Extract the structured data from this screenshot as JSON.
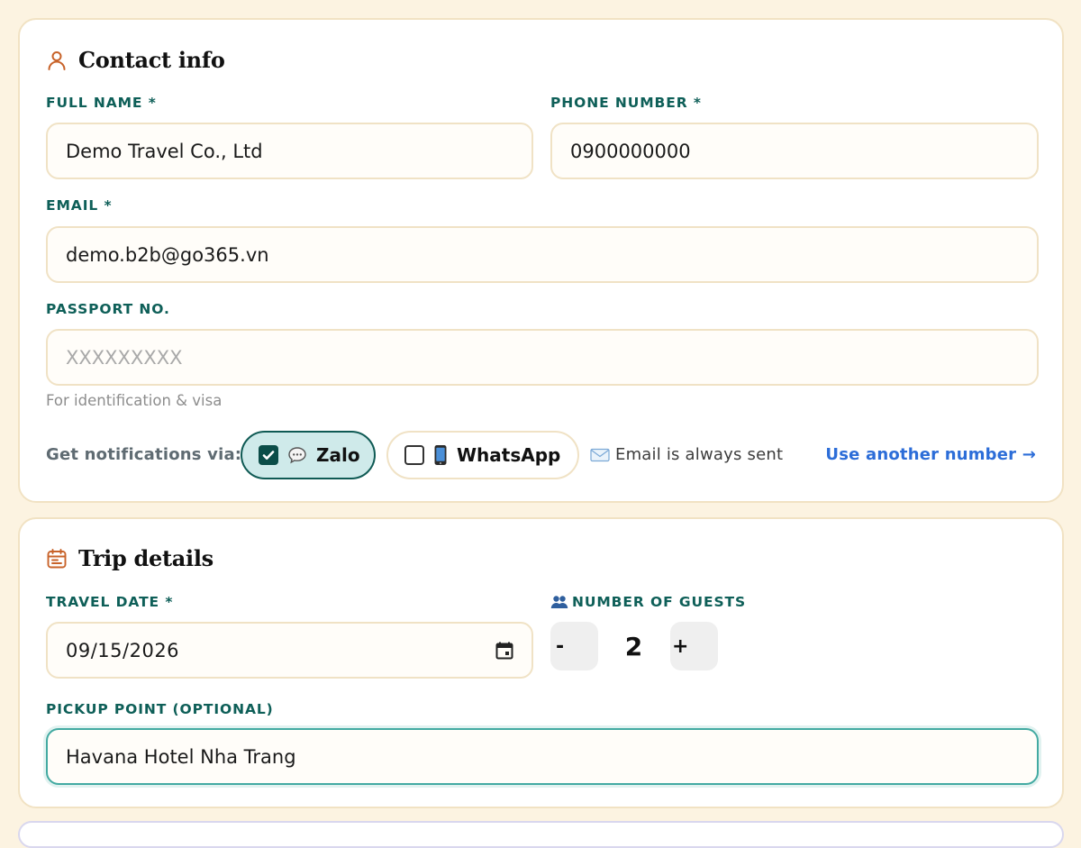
{
  "contact": {
    "title": "Contact info",
    "full_name": {
      "label": "FULL NAME *",
      "value": "Demo Travel Co., Ltd"
    },
    "phone": {
      "label": "PHONE NUMBER *",
      "value": "0900000000"
    },
    "email": {
      "label": "EMAIL *",
      "value": "demo.b2b@go365.vn"
    },
    "passport": {
      "label": "PASSPORT NO.",
      "value": "",
      "placeholder": "XXXXXXXXX",
      "hint": "For identification & visa"
    },
    "notify": {
      "label": "Get notifications via:",
      "zalo": {
        "label": "Zalo",
        "checked": true,
        "icon": "speech-bubble-icon"
      },
      "whatsapp": {
        "label": "WhatsApp",
        "checked": false,
        "icon": "mobile-phone-icon"
      },
      "email_note": "Email is always sent",
      "email_note_icon": "envelope-icon",
      "use_another": "Use another number →"
    }
  },
  "trip": {
    "title": "Trip details",
    "travel_date": {
      "label": "TRAVEL DATE *",
      "value": "09/15/2026"
    },
    "guests": {
      "label": "NUMBER OF GUESTS",
      "icon": "people-icon",
      "value": "2",
      "minus": "-",
      "plus": "+"
    },
    "pickup": {
      "label": "PICKUP POINT (OPTIONAL)",
      "value": "Havana Hotel Nha Trang"
    }
  },
  "colors": {
    "background": "#fcf3e1",
    "label_teal": "#0e5f58",
    "accent_orange": "#c8632a",
    "link_blue": "#2c6dd8"
  }
}
